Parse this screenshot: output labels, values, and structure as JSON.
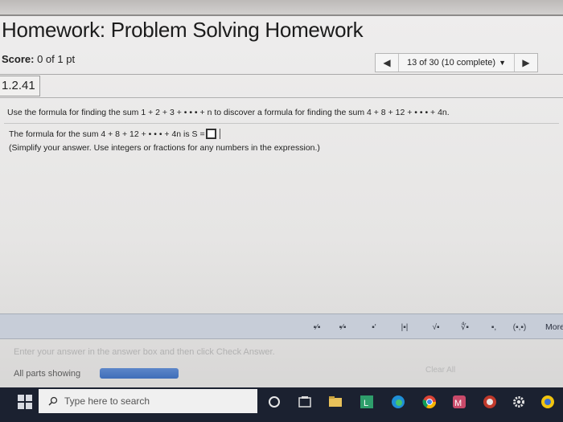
{
  "assignment": {
    "title": "Homework: Problem Solving Homework",
    "score_label": "Score:",
    "score_value": "0 of 1 pt"
  },
  "question_nav": {
    "prev_icon": "triangle-left-icon",
    "selector_text": "13 of 30 (10 complete)",
    "selector_caret": "▼",
    "next_icon": "triangle-right-icon"
  },
  "question": {
    "number": "1.2.41",
    "prompt": "Use the formula for finding the sum 1 + 2 + 3 + • • • + n to discover a formula for finding the sum 4 + 8 + 12 + • • • + 4n.",
    "answer_prefix": "The formula for the sum 4 + 8 + 12 + • • • + 4n is S =",
    "answer_value": "",
    "instruction": "(Simplify your answer. Use integers or fractions for any numbers in the expression.)"
  },
  "math_toolbar": {
    "buttons": [
      {
        "name": "fraction-button",
        "glyph": "▪⁄▪"
      },
      {
        "name": "mixed-number-button",
        "glyph": "▪⁄▪"
      },
      {
        "name": "exponent-button",
        "glyph": "▪'"
      },
      {
        "name": "absolute-value-button",
        "glyph": "|▪|"
      },
      {
        "name": "square-root-button",
        "glyph": "√▪"
      },
      {
        "name": "nth-root-button",
        "glyph": "∜▪"
      },
      {
        "name": "subscript-button",
        "glyph": "▪,"
      },
      {
        "name": "ordered-pair-button",
        "glyph": "(▪,▪)"
      }
    ],
    "more_label": "More"
  },
  "footer": {
    "instruction": "Enter your answer in the answer box and then click Check Answer.",
    "all_parts_label": "All parts showing",
    "progress_fraction": 1.0,
    "clear_all_label": "Clear All"
  },
  "taskbar": {
    "search_placeholder": "Type here to search",
    "apps": [
      "cortana-icon",
      "task-view-icon",
      "file-explorer-icon",
      "store-icon",
      "photos-icon",
      "edge-icon",
      "chrome-icon",
      "app-icon",
      "office-icon",
      "settings-icon",
      "app2-icon"
    ]
  },
  "colors": {
    "toolbar_bg": "#c7cdd8",
    "progress_fill": "#3f6eb9",
    "taskbar_bg": "#1b2130"
  }
}
